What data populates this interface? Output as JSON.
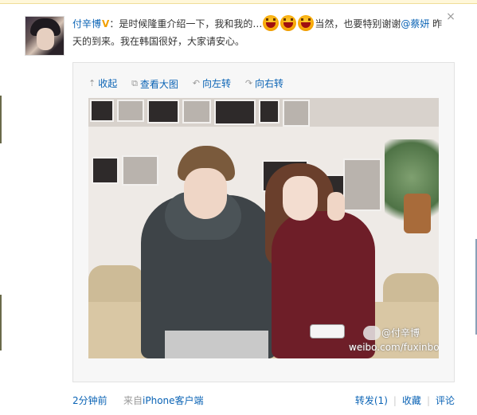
{
  "post": {
    "username": "付辛博",
    "verified_badge": "V",
    "text_part1": "：是时候隆重介绍一下，我和我的…",
    "text_part2": "当然，也要特别谢谢",
    "mention": "@蔡妍",
    "text_part3": " 昨天的到来。我在韩国很好，大家请安心。",
    "emoji_name": "laughing-face-icon"
  },
  "close_label": "×",
  "media_tools": {
    "collapse": "收起",
    "view_large": "查看大图",
    "rotate_left": "向左转",
    "rotate_right": "向右转"
  },
  "photo": {
    "watermark_name": "@付辛博",
    "watermark_url": "weibo.com/fuxinbo"
  },
  "footer": {
    "time": "2分钟前",
    "source_prefix": "来自",
    "source_app": "iPhone客户端",
    "repost": "转发(1)",
    "favorite": "收藏",
    "comment": "评论",
    "separator": "|"
  }
}
